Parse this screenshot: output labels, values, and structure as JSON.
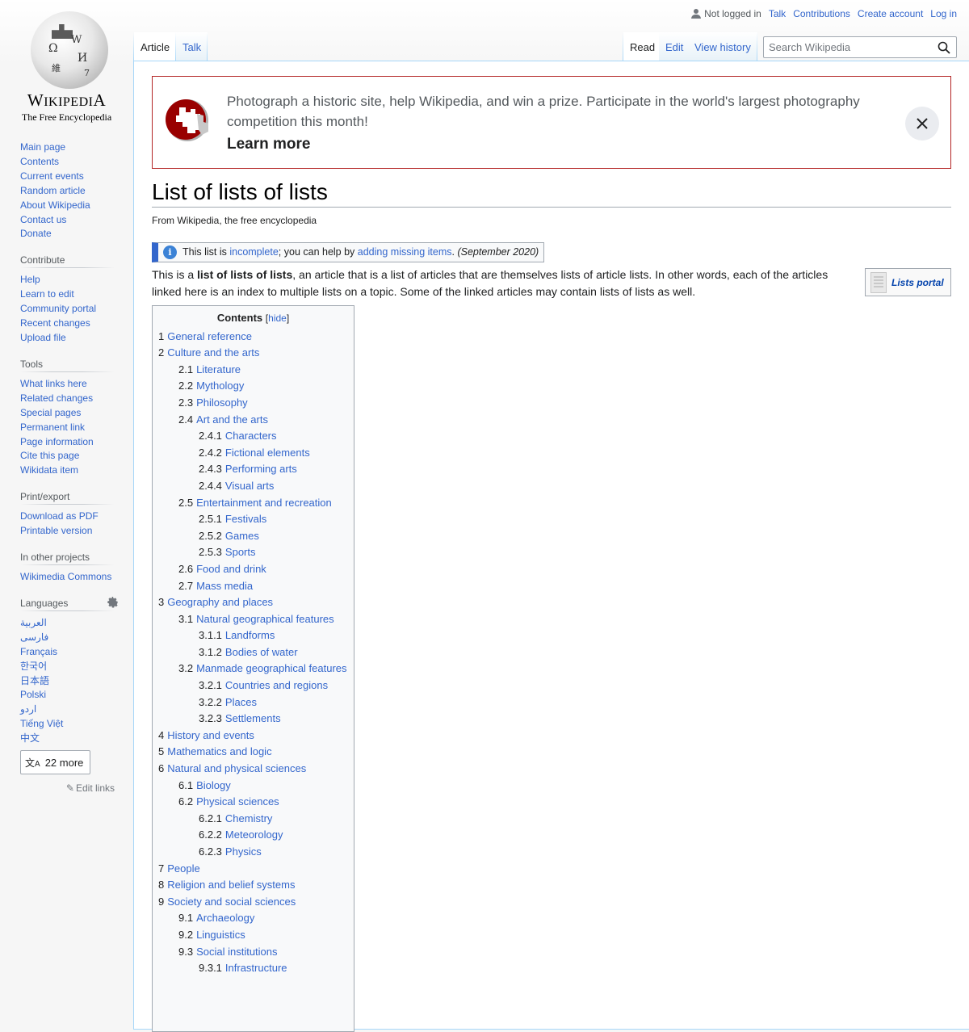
{
  "logo": {
    "wordmark": "Wikipedia",
    "tagline": "The Free Encyclopedia"
  },
  "personal_tools": {
    "status": "Not logged in",
    "links": [
      "Talk",
      "Contributions",
      "Create account",
      "Log in"
    ]
  },
  "tabs": {
    "left": [
      {
        "label": "Article",
        "selected": true
      },
      {
        "label": "Talk",
        "selected": false
      }
    ],
    "right": [
      {
        "label": "Read",
        "selected": true
      },
      {
        "label": "Edit",
        "selected": false
      },
      {
        "label": "View history",
        "selected": false
      }
    ]
  },
  "search": {
    "placeholder": "Search Wikipedia",
    "value": ""
  },
  "sidebar": {
    "navigation": [
      "Main page",
      "Contents",
      "Current events",
      "Random article",
      "About Wikipedia",
      "Contact us",
      "Donate"
    ],
    "contribute": {
      "heading": "Contribute",
      "items": [
        "Help",
        "Learn to edit",
        "Community portal",
        "Recent changes",
        "Upload file"
      ]
    },
    "tools": {
      "heading": "Tools",
      "items": [
        "What links here",
        "Related changes",
        "Special pages",
        "Permanent link",
        "Page information",
        "Cite this page",
        "Wikidata item"
      ]
    },
    "print": {
      "heading": "Print/export",
      "items": [
        "Download as PDF",
        "Printable version"
      ]
    },
    "other_projects": {
      "heading": "In other projects",
      "items": [
        "Wikimedia Commons"
      ]
    },
    "languages": {
      "heading": "Languages",
      "items": [
        "العربية",
        "فارسی",
        "Français",
        "한국어",
        "日本語",
        "Polski",
        "اردو",
        "Tiếng Việt",
        "中文"
      ],
      "more_label": "22 more",
      "edit_links": "Edit links"
    }
  },
  "banner": {
    "text": "Photograph a historic site, help Wikipedia, and win a prize. Participate in the world's largest photography competition this month!",
    "cta": "Learn more",
    "accent_color": "#b32424"
  },
  "article": {
    "title": "List of lists of lists",
    "tagline": "From Wikipedia, the free encyclopedia",
    "notice": {
      "prefix": "This list is ",
      "link1": "incomplete",
      "middle": "; you can help by ",
      "link2": "adding missing items",
      "suffix": ". ",
      "date": "(September 2020)"
    },
    "intro": {
      "before": "This is a ",
      "bold": "list of lists of lists",
      "after": ", an article that is a list of articles that are themselves lists of article lists. In other words, each of the articles linked here is an index to multiple lists on a topic. Some of the linked articles may contain lists of lists as well."
    },
    "portal_box": "Lists portal"
  },
  "toc": {
    "title": "Contents",
    "toggle": "hide",
    "items": [
      {
        "num": "1",
        "label": "General reference",
        "level": 1
      },
      {
        "num": "2",
        "label": "Culture and the arts",
        "level": 1
      },
      {
        "num": "2.1",
        "label": "Literature",
        "level": 2
      },
      {
        "num": "2.2",
        "label": "Mythology",
        "level": 2
      },
      {
        "num": "2.3",
        "label": "Philosophy",
        "level": 2
      },
      {
        "num": "2.4",
        "label": "Art and the arts",
        "level": 2
      },
      {
        "num": "2.4.1",
        "label": "Characters",
        "level": 3
      },
      {
        "num": "2.4.2",
        "label": "Fictional elements",
        "level": 3
      },
      {
        "num": "2.4.3",
        "label": "Performing arts",
        "level": 3
      },
      {
        "num": "2.4.4",
        "label": "Visual arts",
        "level": 3
      },
      {
        "num": "2.5",
        "label": "Entertainment and recreation",
        "level": 2
      },
      {
        "num": "2.5.1",
        "label": "Festivals",
        "level": 3
      },
      {
        "num": "2.5.2",
        "label": "Games",
        "level": 3
      },
      {
        "num": "2.5.3",
        "label": "Sports",
        "level": 3
      },
      {
        "num": "2.6",
        "label": "Food and drink",
        "level": 2
      },
      {
        "num": "2.7",
        "label": "Mass media",
        "level": 2
      },
      {
        "num": "3",
        "label": "Geography and places",
        "level": 1
      },
      {
        "num": "3.1",
        "label": "Natural geographical features",
        "level": 2
      },
      {
        "num": "3.1.1",
        "label": "Landforms",
        "level": 3
      },
      {
        "num": "3.1.2",
        "label": "Bodies of water",
        "level": 3
      },
      {
        "num": "3.2",
        "label": "Manmade geographical features",
        "level": 2
      },
      {
        "num": "3.2.1",
        "label": "Countries and regions",
        "level": 3
      },
      {
        "num": "3.2.2",
        "label": "Places",
        "level": 3
      },
      {
        "num": "3.2.3",
        "label": "Settlements",
        "level": 3
      },
      {
        "num": "4",
        "label": "History and events",
        "level": 1
      },
      {
        "num": "5",
        "label": "Mathematics and logic",
        "level": 1
      },
      {
        "num": "6",
        "label": "Natural and physical sciences",
        "level": 1
      },
      {
        "num": "6.1",
        "label": "Biology",
        "level": 2
      },
      {
        "num": "6.2",
        "label": "Physical sciences",
        "level": 2
      },
      {
        "num": "6.2.1",
        "label": "Chemistry",
        "level": 3
      },
      {
        "num": "6.2.2",
        "label": "Meteorology",
        "level": 3
      },
      {
        "num": "6.2.3",
        "label": "Physics",
        "level": 3
      },
      {
        "num": "7",
        "label": "People",
        "level": 1
      },
      {
        "num": "8",
        "label": "Religion and belief systems",
        "level": 1
      },
      {
        "num": "9",
        "label": "Society and social sciences",
        "level": 1
      },
      {
        "num": "9.1",
        "label": "Archaeology",
        "level": 2
      },
      {
        "num": "9.2",
        "label": "Linguistics",
        "level": 2
      },
      {
        "num": "9.3",
        "label": "Social institutions",
        "level": 2
      },
      {
        "num": "9.3.1",
        "label": "Infrastructure",
        "level": 3
      }
    ]
  }
}
